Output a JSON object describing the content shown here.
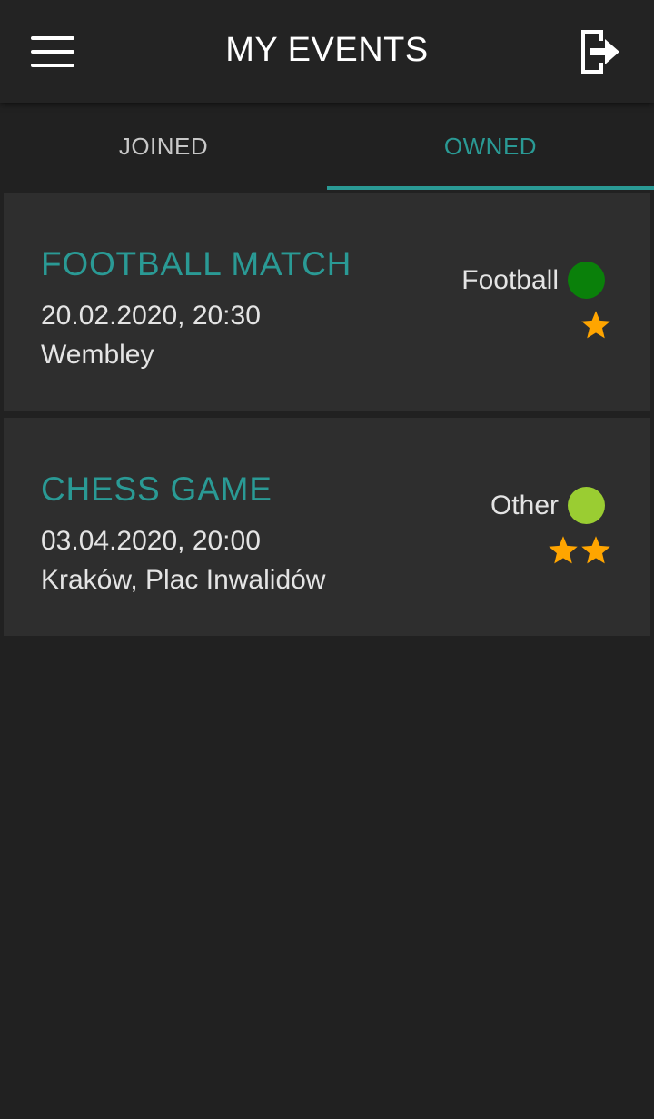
{
  "header": {
    "title": "MY EVENTS",
    "menu_icon": "hamburger-menu-icon",
    "logout_icon": "logout-icon"
  },
  "tabs": [
    {
      "label": "JOINED",
      "active": false
    },
    {
      "label": "OWNED",
      "active": true
    }
  ],
  "events": [
    {
      "title": "FOOTBALL MATCH",
      "datetime": "20.02.2020, 20:30",
      "location": "Wembley",
      "category": "Football",
      "category_color": "#0a800a",
      "difficulty_stars": 1
    },
    {
      "title": "CHESS GAME",
      "datetime": "03.04.2020, 20:00",
      "location": "Kraków, Plac Inwalidów",
      "category": "Other",
      "category_color": "#9acd32",
      "difficulty_stars": 2
    }
  ],
  "colors": {
    "accent": "#2a9a95",
    "star": "#ffa500",
    "background": "#212121",
    "card": "#2e2e2e"
  }
}
